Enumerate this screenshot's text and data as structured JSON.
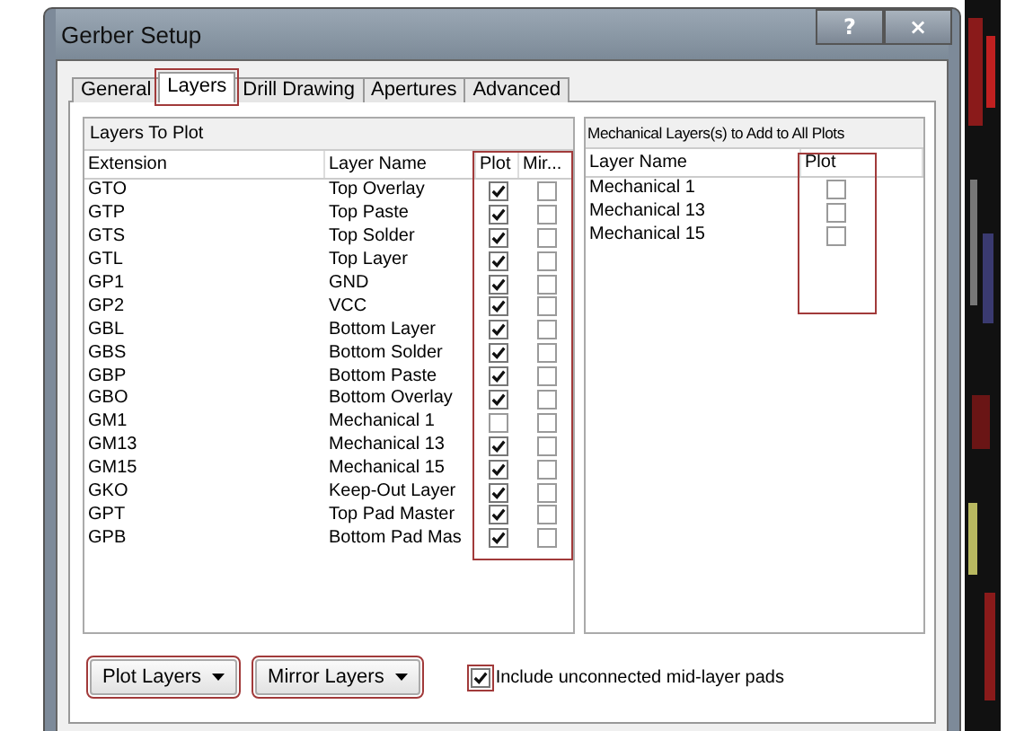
{
  "window": {
    "title": "Gerber Setup",
    "help_button": "?",
    "close_button": "×"
  },
  "tabs": [
    {
      "label": "General",
      "selected": false,
      "highlighted": false
    },
    {
      "label": "Layers",
      "selected": true,
      "highlighted": true
    },
    {
      "label": "Drill Drawing",
      "selected": false,
      "highlighted": false
    },
    {
      "label": "Apertures",
      "selected": false,
      "highlighted": false
    },
    {
      "label": "Advanced",
      "selected": false,
      "highlighted": false
    }
  ],
  "layers_panel": {
    "title": "Layers To Plot",
    "columns": [
      "Extension",
      "Layer Name",
      "Plot",
      "Mir..."
    ],
    "check_columns_highlighted": true,
    "rows": [
      {
        "extension": "GTO",
        "layer_name": "Top Overlay",
        "plot": true,
        "mirror": false
      },
      {
        "extension": "GTP",
        "layer_name": "Top Paste",
        "plot": true,
        "mirror": false
      },
      {
        "extension": "GTS",
        "layer_name": "Top Solder",
        "plot": true,
        "mirror": false
      },
      {
        "extension": "GTL",
        "layer_name": "Top Layer",
        "plot": true,
        "mirror": false
      },
      {
        "extension": "GP1",
        "layer_name": "GND",
        "plot": true,
        "mirror": false
      },
      {
        "extension": "GP2",
        "layer_name": "VCC",
        "plot": true,
        "mirror": false
      },
      {
        "extension": "GBL",
        "layer_name": "Bottom Layer",
        "plot": true,
        "mirror": false
      },
      {
        "extension": "GBS",
        "layer_name": "Bottom Solder",
        "plot": true,
        "mirror": false
      },
      {
        "extension": "GBP",
        "layer_name": "Bottom Paste",
        "plot": true,
        "mirror": false
      },
      {
        "extension": "GBO",
        "layer_name": "Bottom Overlay",
        "plot": true,
        "mirror": false
      },
      {
        "extension": "GM1",
        "layer_name": "Mechanical 1",
        "plot": false,
        "mirror": false
      },
      {
        "extension": "GM13",
        "layer_name": "Mechanical 13",
        "plot": true,
        "mirror": false
      },
      {
        "extension": "GM15",
        "layer_name": "Mechanical 15",
        "plot": true,
        "mirror": false
      },
      {
        "extension": "GKO",
        "layer_name": "Keep-Out Layer",
        "plot": true,
        "mirror": false
      },
      {
        "extension": "GPT",
        "layer_name": "Top Pad Master",
        "plot": true,
        "mirror": false
      },
      {
        "extension": "GPB",
        "layer_name": "Bottom Pad Mas",
        "plot": true,
        "mirror": false
      }
    ]
  },
  "mechanical_panel": {
    "title": "Mechanical Layers(s) to Add to All Plots",
    "columns": [
      "Layer Name",
      "Plot"
    ],
    "plot_column_highlighted": true,
    "rows": [
      {
        "layer_name": "Mechanical 1",
        "plot": false
      },
      {
        "layer_name": "Mechanical 13",
        "plot": false
      },
      {
        "layer_name": "Mechanical 15",
        "plot": false
      }
    ]
  },
  "buttons": [
    {
      "label": "Plot Layers",
      "highlighted": true
    },
    {
      "label": "Mirror Layers",
      "highlighted": true
    }
  ],
  "option": {
    "label": "Include unconnected mid-layer pads",
    "checked": true,
    "highlighted": true
  }
}
